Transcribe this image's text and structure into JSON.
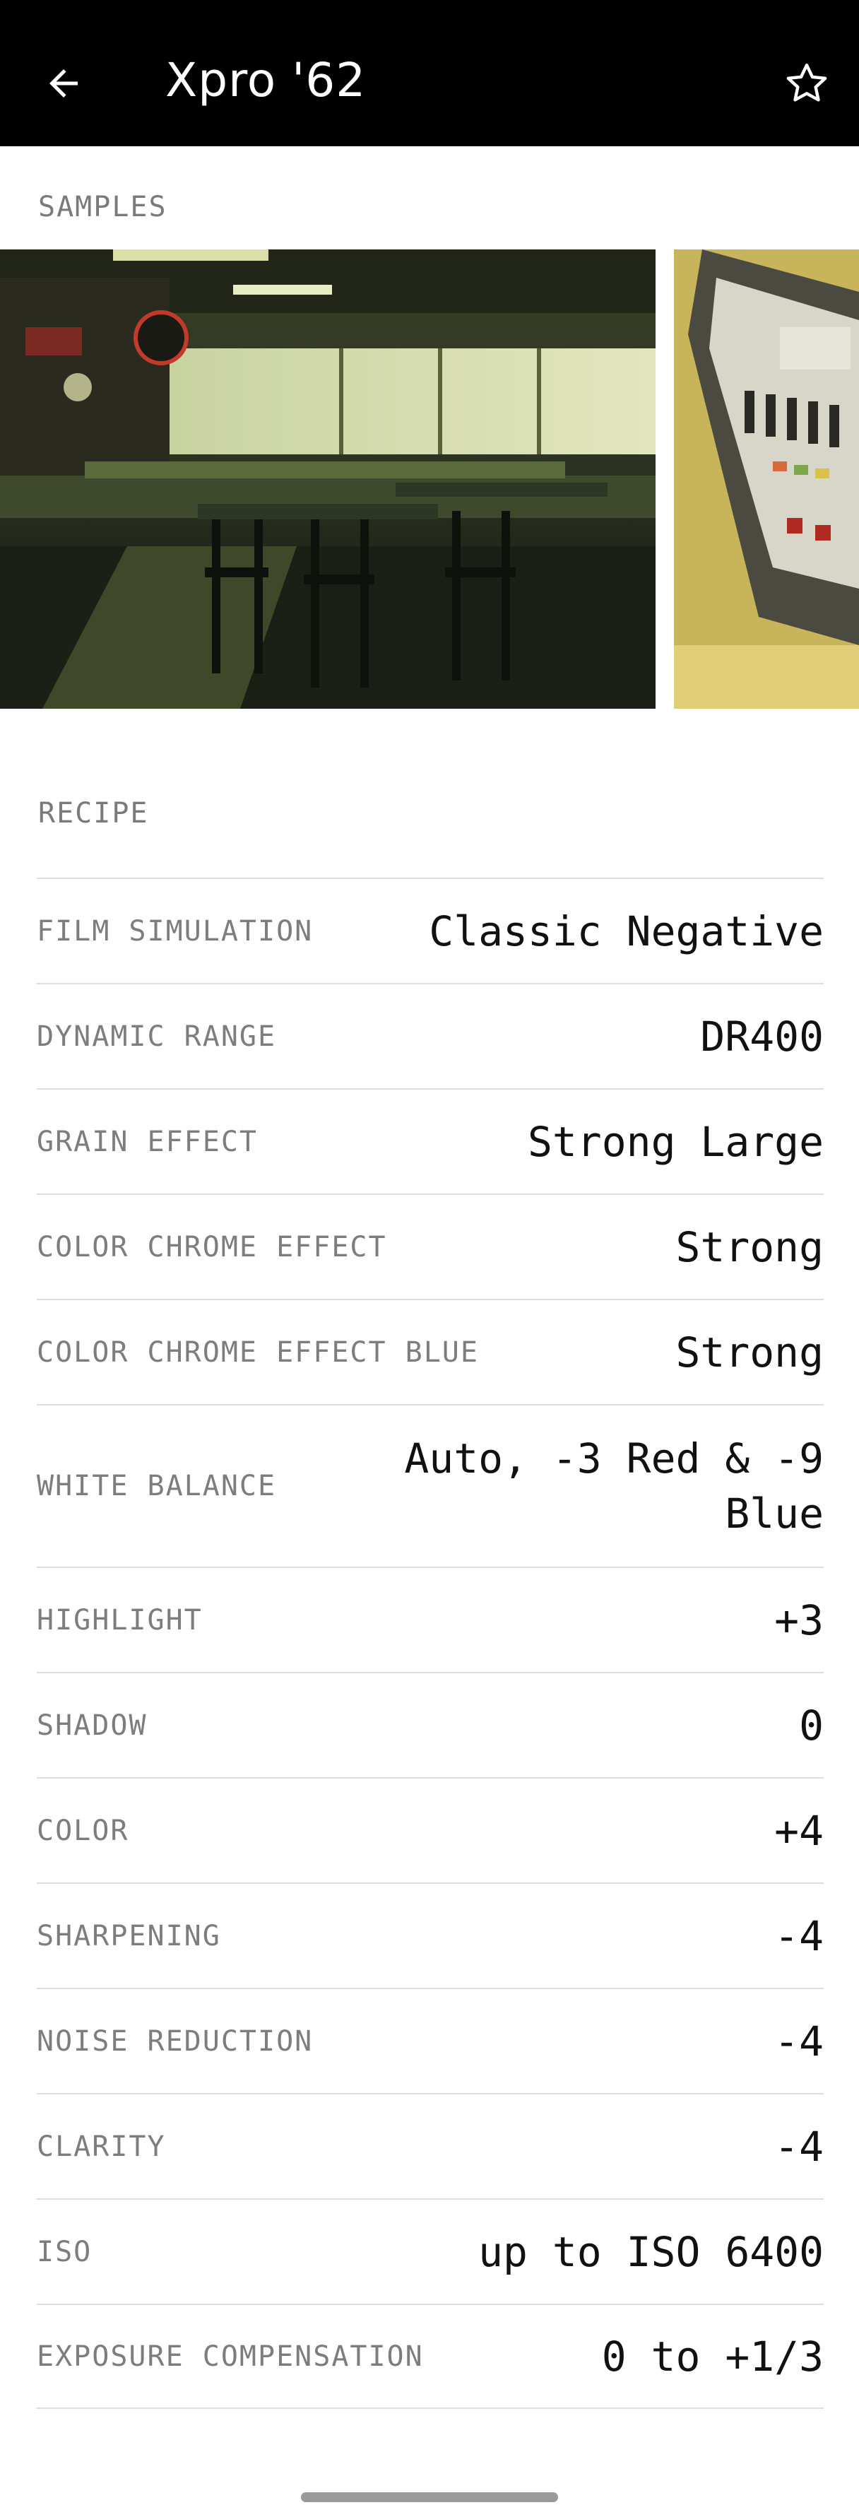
{
  "appbar": {
    "title": "Xpro '62",
    "back_icon": "arrow-left-icon",
    "favorite_icon": "star-outline-icon"
  },
  "samples": {
    "label": "SAMPLES",
    "images": [
      {
        "name": "diner-interior-photo"
      },
      {
        "name": "cigarette-machine-photo"
      }
    ]
  },
  "recipe": {
    "label": "RECIPE",
    "rows": [
      {
        "key": "FILM SIMULATION",
        "value": "Classic Negative"
      },
      {
        "key": "DYNAMIC RANGE",
        "value": "DR400"
      },
      {
        "key": "GRAIN EFFECT",
        "value": "Strong Large"
      },
      {
        "key": "COLOR CHROME EFFECT",
        "value": "Strong"
      },
      {
        "key": "COLOR CHROME EFFECT BLUE",
        "value": "Strong"
      },
      {
        "key": "WHITE BALANCE",
        "value": "Auto, -3 Red & -9 Blue"
      },
      {
        "key": "HIGHLIGHT",
        "value": "+3"
      },
      {
        "key": "SHADOW",
        "value": "0"
      },
      {
        "key": "COLOR",
        "value": "+4"
      },
      {
        "key": "SHARPENING",
        "value": "-4"
      },
      {
        "key": "NOISE REDUCTION",
        "value": "-4"
      },
      {
        "key": "CLARITY",
        "value": "-4"
      },
      {
        "key": "ISO",
        "value": "up to ISO 6400"
      },
      {
        "key": "EXPOSURE COMPENSATION",
        "value": "0 to +1/3"
      }
    ]
  }
}
